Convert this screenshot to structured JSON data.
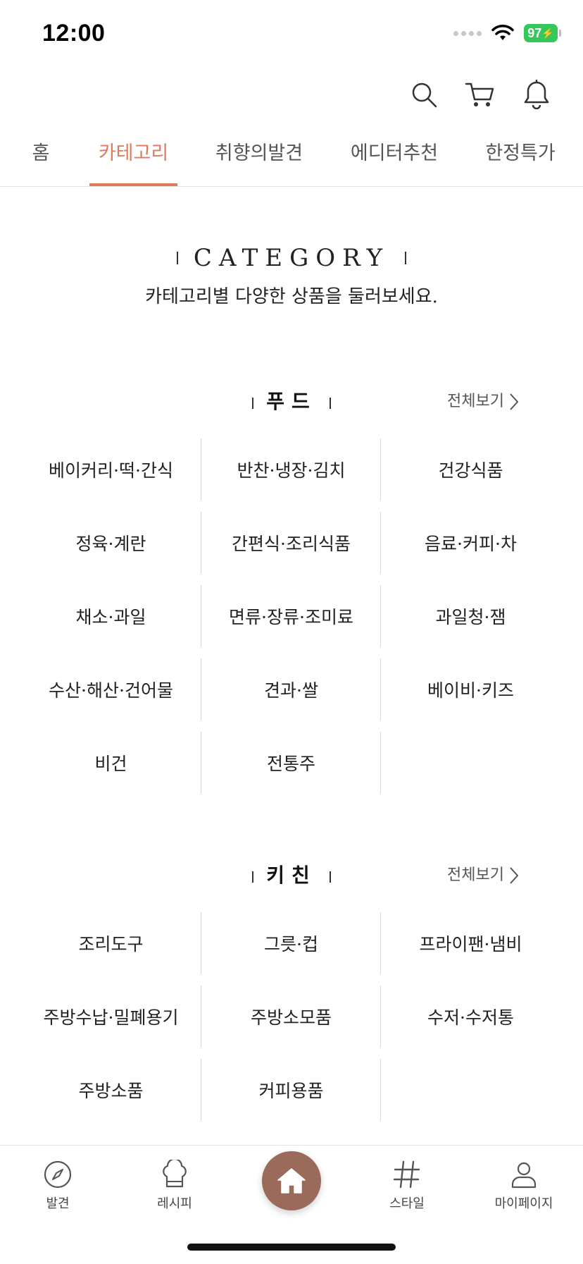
{
  "status": {
    "time": "12:00",
    "battery": "97"
  },
  "tabs": [
    {
      "label": "홈"
    },
    {
      "label": "카테고리",
      "active": true
    },
    {
      "label": "취향의발견"
    },
    {
      "label": "에디터추천"
    },
    {
      "label": "한정특가"
    }
  ],
  "hero": {
    "title": "CATEGORY",
    "subtitle": "카테고리별 다양한 상품을 둘러보세요."
  },
  "sections": [
    {
      "title": "푸드",
      "see_all": "전체보기",
      "items": [
        "베이커리·떡·간식",
        "반찬·냉장·김치",
        "건강식품",
        "정육·계란",
        "간편식·조리식품",
        "음료·커피·차",
        "채소·과일",
        "면류·장류·조미료",
        "과일청·잼",
        "수산·해산·건어물",
        "견과·쌀",
        "베이비·키즈",
        "비건",
        "전통주"
      ]
    },
    {
      "title": "키친",
      "see_all": "전체보기",
      "items": [
        "조리도구",
        "그릇·컵",
        "프라이팬·냄비",
        "주방수납·밀폐용기",
        "주방소모품",
        "수저·수저통",
        "주방소품",
        "커피용품"
      ]
    }
  ],
  "bottom_nav": [
    {
      "label": "발견",
      "icon": "compass-icon"
    },
    {
      "label": "레시피",
      "icon": "chef-hat-icon"
    },
    {
      "label": "",
      "icon": "home-icon"
    },
    {
      "label": "스타일",
      "icon": "hashtag-icon"
    },
    {
      "label": "마이페이지",
      "icon": "person-icon"
    }
  ],
  "colors": {
    "accent": "#e07a5f",
    "home_button": "#9a6a5b",
    "divider": "#d9d9d9"
  }
}
